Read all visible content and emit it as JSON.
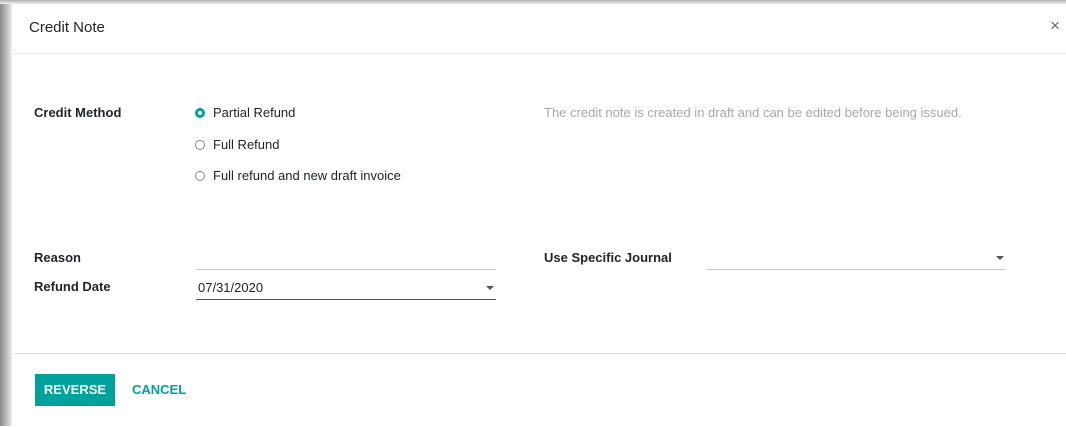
{
  "dialog": {
    "title": "Credit Note",
    "close_glyph": "×"
  },
  "form": {
    "credit_method": {
      "label": "Credit Method",
      "options": [
        {
          "label": "Partial Refund",
          "selected": true
        },
        {
          "label": "Full Refund",
          "selected": false
        },
        {
          "label": "Full refund and new draft invoice",
          "selected": false
        }
      ],
      "help": "The credit note is created in draft and can be edited before being issued."
    },
    "reason": {
      "label": "Reason",
      "value": ""
    },
    "refund_date": {
      "label": "Refund Date",
      "value": "07/31/2020"
    },
    "journal": {
      "label": "Use Specific Journal",
      "value": ""
    }
  },
  "footer": {
    "reverse_label": "REVERSE",
    "cancel_label": "CANCEL"
  },
  "colors": {
    "accent": "#00a09d",
    "help_text": "#a8a8a8"
  }
}
